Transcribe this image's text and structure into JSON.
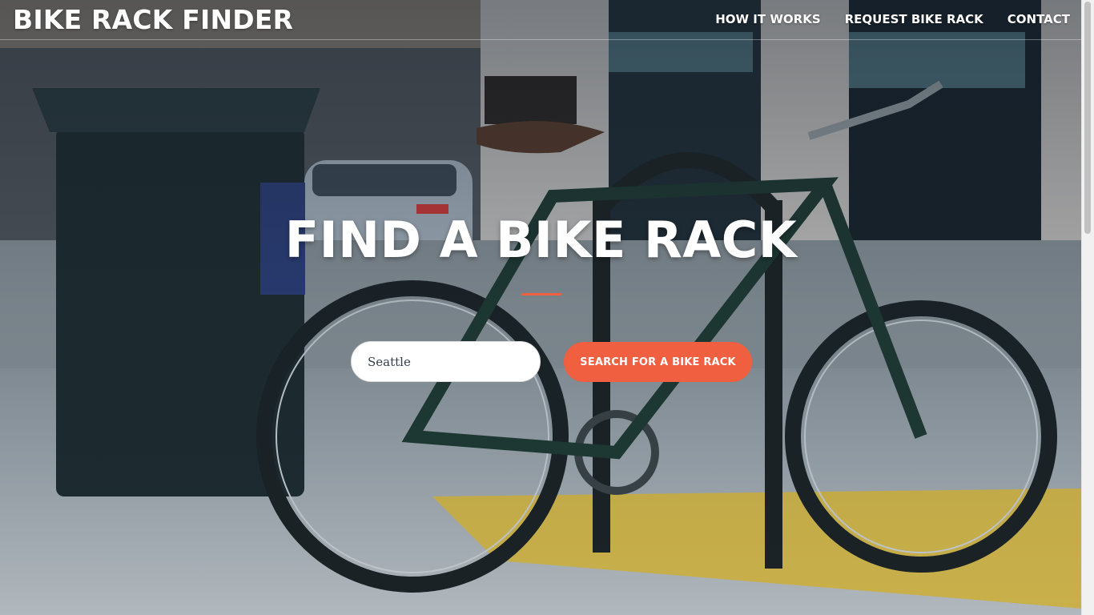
{
  "navbar": {
    "brand": "BIKE RACK FINDER",
    "links": [
      {
        "label": "HOW IT WORKS"
      },
      {
        "label": "REQUEST BIKE RACK"
      },
      {
        "label": "CONTACT"
      }
    ]
  },
  "hero": {
    "title": "FIND A BIKE RACK",
    "search": {
      "value": "Seattle",
      "button_label": "SEARCH FOR A BIKE RACK"
    }
  },
  "colors": {
    "accent": "#f05f40",
    "text_on_photo": "#ffffff"
  },
  "background": {
    "icon": "bike-street-photo"
  }
}
